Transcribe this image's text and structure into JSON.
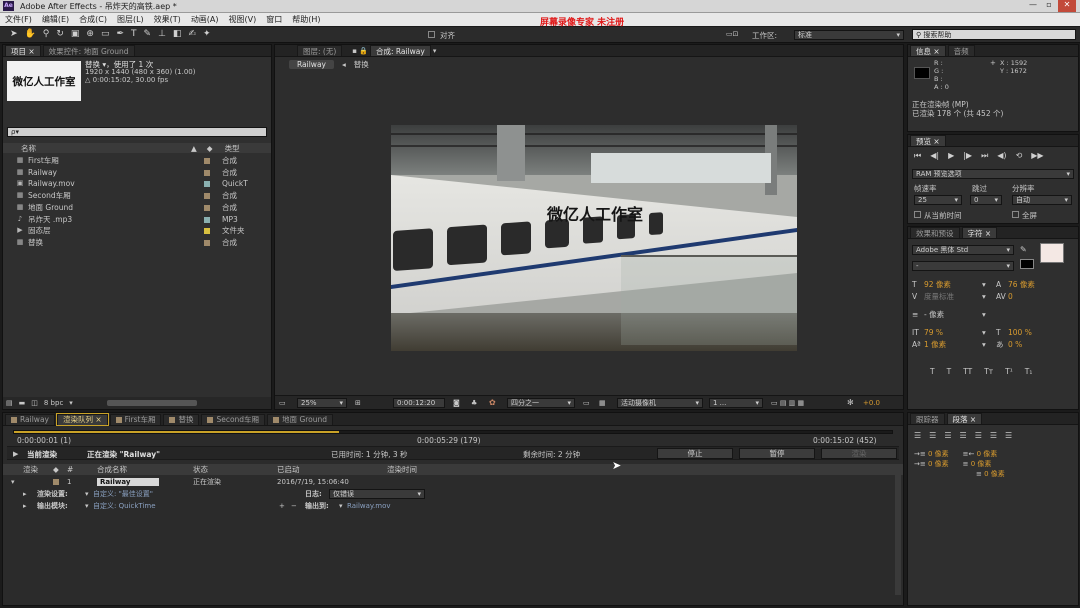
{
  "titlebar": {
    "title": "Adobe After Effects - 吊炸天的高铁.aep *",
    "app_icon": "Ae"
  },
  "menu": [
    "文件(F)",
    "编辑(E)",
    "合成(C)",
    "图层(L)",
    "效果(T)",
    "动画(A)",
    "视图(V)",
    "窗口",
    "帮助(H)"
  ],
  "watermark": "屏幕录像专家  未注册",
  "toolbar": {
    "align_label": "对齐",
    "workspace_label": "工作区:",
    "workspace_value": "标准",
    "search_placeholder": "搜索帮助"
  },
  "project": {
    "tabs": [
      "项目 ×",
      "效果控件: 地面 Ground"
    ],
    "thumb_text": "微亿人工作室",
    "item_name": "替换 ▾，使用了 1 次",
    "item_info1": "1920 x 1440  (480 x 360) (1.00)",
    "item_info2": "△ 0:00:15:02, 30.00 fps",
    "search_placeholder": "ρ▾",
    "col_name": "名称",
    "col_type": "类型",
    "items": [
      {
        "icon": "comp-icon",
        "name": "First车厢",
        "type": "合成",
        "color": "#a08a6a"
      },
      {
        "icon": "comp-icon",
        "name": "Railway",
        "type": "合成",
        "color": "#a08a6a"
      },
      {
        "icon": "footage-icon",
        "name": "Railway.mov",
        "type": "QuickT",
        "color": "#8ab0b0"
      },
      {
        "icon": "comp-icon",
        "name": "Second车厢",
        "type": "合成",
        "color": "#a08a6a"
      },
      {
        "icon": "comp-icon",
        "name": "地面 Ground",
        "type": "合成",
        "color": "#a08a6a"
      },
      {
        "icon": "audio-icon",
        "name": "吊炸天 .mp3",
        "type": "MP3",
        "color": "#8ab0b0"
      },
      {
        "icon": "folder-icon",
        "name": "固态层",
        "type": "文件夹",
        "color": "#d8c040"
      },
      {
        "icon": "comp-icon",
        "name": "替换",
        "type": "合成",
        "color": "#a08a6a"
      }
    ],
    "bpc": "8 bpc"
  },
  "viewer": {
    "tabs": [
      "图层: (无)",
      "合成: Railway"
    ],
    "breadcrumb": "Railway",
    "breadcrumb2": "替换",
    "overlay_text": "微亿人工作室",
    "zoom": "25%",
    "timecode": "0:00:12:20",
    "view": "四分之一",
    "camera": "活动摄像机",
    "views": "1 ...",
    "exposure": "+0.0"
  },
  "info": {
    "tabs": [
      "信息 ×",
      "音频"
    ],
    "r": "R :",
    "g": "G :",
    "b": "B :",
    "a": "A : 0",
    "x": "X : 1592",
    "y": "Y : 1672",
    "status1": "正在渲染帧 (MP)",
    "status2": "已渲染 178 个 (共 452 个)"
  },
  "preview": {
    "tab": "预览 ×",
    "options": "RAM 预览选项",
    "fps_label": "帧速率",
    "skip_label": "跳过",
    "res_label": "分辨率",
    "fps": "25",
    "skip": "0",
    "res": "自动",
    "from_current": "从当前时间",
    "fullscreen": "全屏"
  },
  "character": {
    "tabs": [
      "效果和预设",
      "字符 ×"
    ],
    "font": "Adobe 黑体 Std",
    "style": "-",
    "size": "92 像素",
    "leading": "76 像素",
    "kerning": "度量标准",
    "tracking": "0",
    "stroke": "- 像素",
    "vscale": "79 %",
    "hscale": "100 %",
    "baseline": "1 像素",
    "tsume": "0 %",
    "styles": [
      "T",
      "T",
      "TT",
      "Tт",
      "T¹",
      "T₁"
    ]
  },
  "paragraph": {
    "tabs": [
      "跟踪器",
      "段落 ×"
    ],
    "indent": [
      "0 像素",
      "0 像素",
      "0 像素",
      "0 像素",
      "0 像素"
    ]
  },
  "timeline": {
    "tabs": [
      "Railway",
      "渲染队列 ×",
      "First车厢",
      "替换",
      "Second车厢",
      "地面 Ground"
    ],
    "t_start": "0:00:00:01 (1)",
    "t_mid": "0:00:05:29 (179)",
    "t_end": "0:00:15:02 (452)",
    "progress": 0.37,
    "current_render_label": "当前渲染",
    "current_render": "正在渲染 \"Railway\"",
    "elapsed": "已用时间: 1 分钟, 3 秒",
    "remain": "剩余时间: 2 分钟",
    "stop": "停止",
    "pause": "暂停",
    "render": "渲染",
    "cols": [
      "渲染",
      "#",
      "合成名称",
      "状态",
      "已启动",
      "渲染时间"
    ],
    "item": {
      "num": "1",
      "name": "Railway",
      "status": "正在渲染",
      "started": "2016/7/19, 15:06:40"
    },
    "render_settings_label": "渲染设置:",
    "render_settings": "自定义: \"最佳设置\"",
    "log_label": "日志:",
    "log": "仅错误",
    "output_module_label": "输出模块:",
    "output_module": "自定义: QuickTime",
    "output_to_label": "输出到:",
    "output_to": "Railway.mov"
  }
}
